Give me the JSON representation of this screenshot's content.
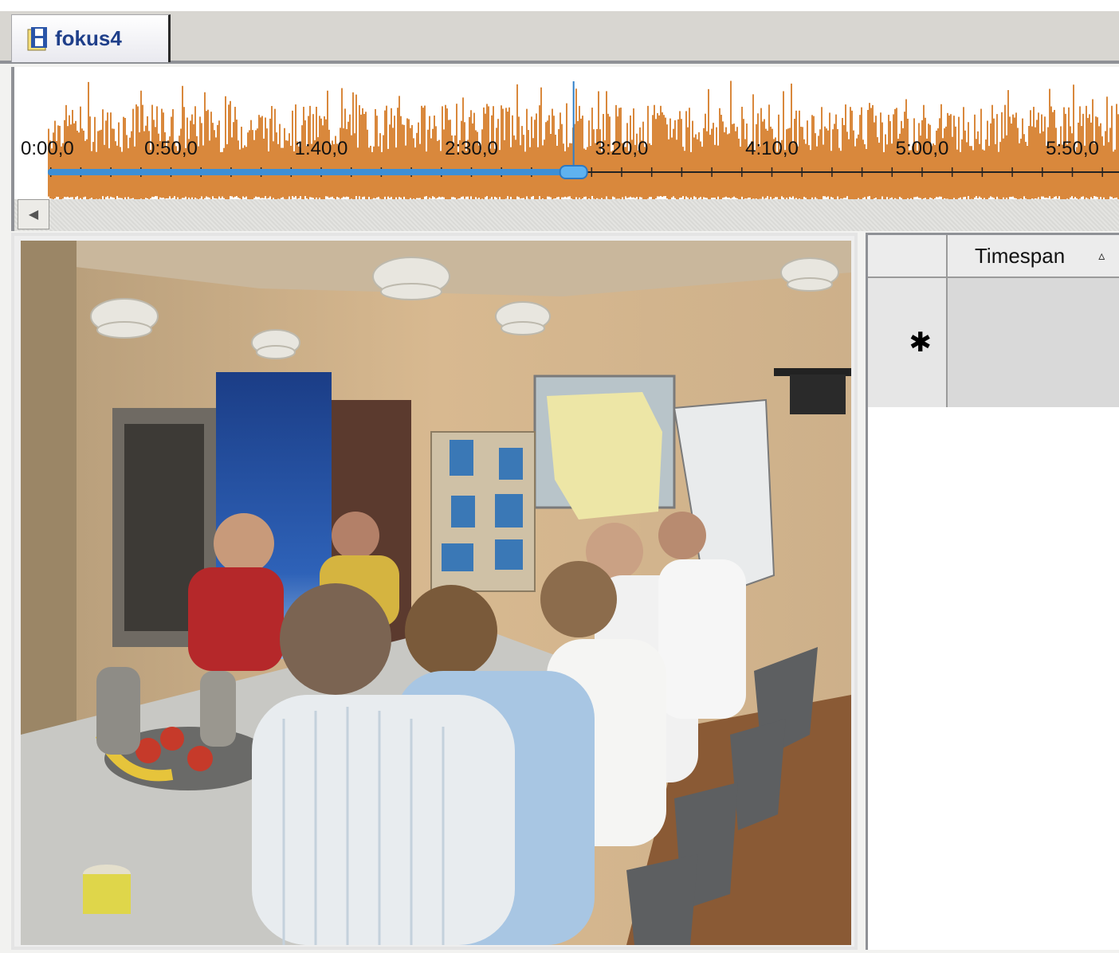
{
  "tab": {
    "label": "fokus4",
    "icon": "film-document-icon"
  },
  "timeline": {
    "tick_labels": [
      "0:00,0",
      "0:50,0",
      "1:40,0",
      "2:30,0",
      "3:20,0",
      "4:10,0",
      "5:00,0",
      "5:50,0"
    ],
    "label_interval_seconds": 50,
    "minor_tick_seconds": 10,
    "playhead_seconds": 184,
    "waveform_color": "#d9883c",
    "progress_color": "#3d8fd6"
  },
  "scrollbar": {
    "left_arrow_icon": "arrow-left-icon"
  },
  "video": {
    "alt": "video-frame",
    "description_icon": "video-still"
  },
  "grid": {
    "columns": [
      {
        "label": "Timespan",
        "sort": "ascending",
        "sort_icon": "sort-ascending-icon"
      }
    ],
    "new_row_marker": "✱"
  },
  "colors": {
    "tab_text": "#1f3f8a",
    "waveform": "#d9883c",
    "playhead": "#2f7fc9"
  }
}
